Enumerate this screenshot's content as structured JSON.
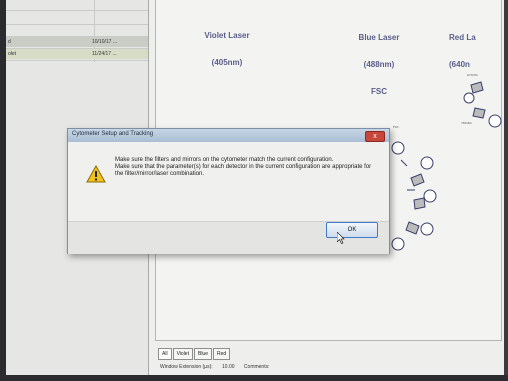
{
  "left_panel": {
    "rows": [
      {
        "name": "d",
        "date": "10/10/17 ..."
      },
      {
        "name": "olet",
        "date": "11/24/17 ..."
      }
    ]
  },
  "diagram": {
    "lasers": [
      {
        "name": "Violet Laser",
        "wavelength": "(405nm)",
        "extra": ""
      },
      {
        "name": "Blue Laser",
        "wavelength": "(488nm)",
        "extra": "FSC"
      },
      {
        "name": "Red La",
        "wavelength": "(640n",
        "extra": ""
      }
    ]
  },
  "tabs": [
    "All",
    "Violet",
    "Blue",
    "Red"
  ],
  "footer": {
    "window_extension_label": "Window Extension (µs):",
    "window_extension_value": "10.00",
    "comments_label": "Comments:"
  },
  "dialog": {
    "title": "Cytometer Setup and Tracking",
    "close_label": "x",
    "message_1": "Make sure the filters and mirrors on the cytometer match the current configuration.",
    "message_2": "Make sure that the parameter(s) for each detector in the current configuration are appropriate for the filter/mirror/laser combination.",
    "ok_label": "OK"
  },
  "colors": {
    "laser_text": "#5a5e8a",
    "close_button": "#c9463a",
    "warning": "#f2c21f"
  }
}
